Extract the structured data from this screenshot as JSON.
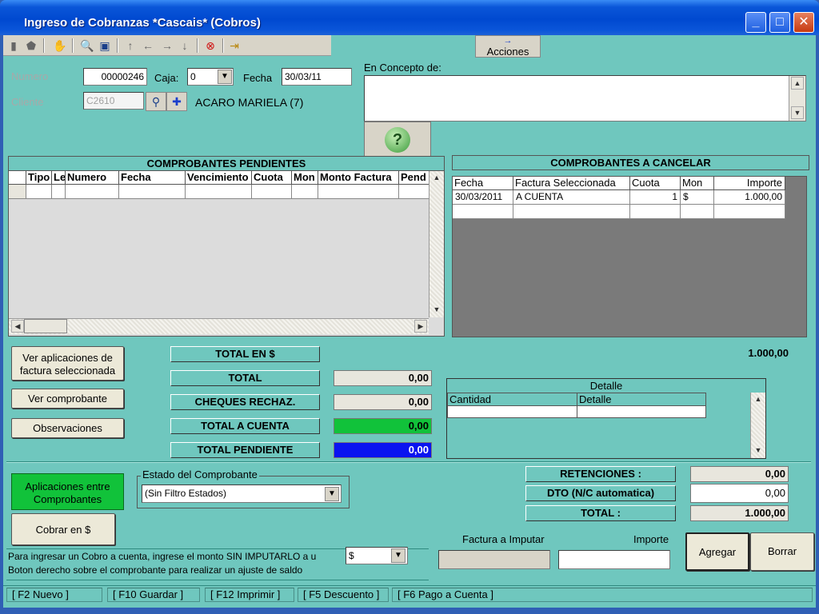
{
  "window": {
    "title": "Ingreso de Cobranzas *Cascais* (Cobros)"
  },
  "toolbar": {
    "acciones_arrow": "→",
    "acciones_label": "Acciones"
  },
  "form": {
    "numero_label": "Numero",
    "numero_value": "00000246",
    "caja_label": "Caja:",
    "caja_value": "0",
    "fecha_label": "Fecha",
    "fecha_value": "30/03/11",
    "cliente_label": "Cliente",
    "cliente_value": "C2610",
    "cliente_nombre": "ACARO MARIELA (7)",
    "concepto_label": "En Concepto de:",
    "help_glyph": "?"
  },
  "pendientes": {
    "header": "COMPROBANTES PENDIENTES",
    "columns": [
      "Tipo",
      "Le",
      "Numero",
      "Fecha",
      "Vencimiento",
      "Cuota",
      "Mon",
      "Monto Factura",
      "Pend"
    ]
  },
  "cancelar": {
    "header": "COMPROBANTES A CANCELAR",
    "columns": [
      "Fecha",
      "Factura Seleccionada",
      "Cuota",
      "Mon",
      "Importe"
    ],
    "rows": [
      [
        "30/03/2011",
        "A CUENTA",
        "1",
        "$",
        "1.000,00"
      ]
    ],
    "total": "1.000,00"
  },
  "buttons": {
    "ver_aplicaciones": "Ver aplicaciones de factura seleccionada",
    "ver_comprobante": "Ver comprobante",
    "observaciones": "Observaciones",
    "aplicaciones_entre": "Aplicaciones entre Comprobantes",
    "cobrar": "Cobrar en $",
    "agregar": "Agregar",
    "borrar": "Borrar"
  },
  "totals": {
    "total_en": "TOTAL EN $",
    "total_label": "TOTAL",
    "total_value": "0,00",
    "cheques_label": "CHEQUES RECHAZ.",
    "cheques_value": "0,00",
    "cuenta_label": "TOTAL A CUENTA",
    "cuenta_value": "0,00",
    "pendiente_label": "TOTAL PENDIENTE",
    "pendiente_value": "0,00"
  },
  "detalle": {
    "title": "Detalle",
    "columns": [
      "Cantidad",
      "Detalle"
    ]
  },
  "retenciones": {
    "ret_label": "RETENCIONES :",
    "ret_value": "0,00",
    "dto_label": "DTO (N/C automatica)",
    "dto_value": "0,00",
    "total_label": "TOTAL :",
    "total_value": "1.000,00"
  },
  "estado": {
    "label": "Estado del Comprobante",
    "value": "(Sin Filtro Estados)"
  },
  "imputar": {
    "info_line1": "Para ingresar un Cobro a cuenta, ingrese el monto SIN IMPUTARLO a u",
    "info_line2": "Boton derecho sobre el comprobante para realizar un ajuste de saldo",
    "moneda": "$",
    "factura_label": "Factura a Imputar",
    "importe_label": "Importe"
  },
  "statusbar": [
    "[ F2 Nuevo ]",
    "[ F10 Guardar ]",
    "[ F12 Imprimir ]",
    "[ F5 Descuento ]",
    "[ F6 Pago a Cuenta ]"
  ],
  "colors": {
    "background": "#6fc7be",
    "title_bar": "#0049d0",
    "green": "#11c23a",
    "blue": "#0a14f0"
  }
}
